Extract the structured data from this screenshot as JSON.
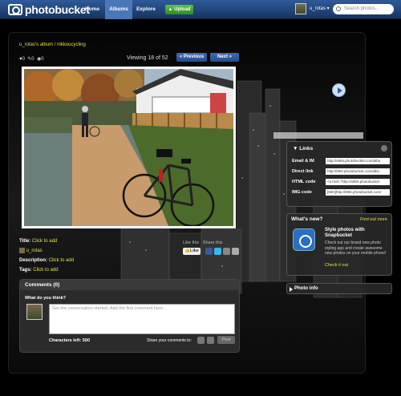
{
  "topbar": {
    "logo": "photobucket",
    "nav": [
      "Home",
      "Albums",
      "Explore"
    ],
    "active_nav": "Albums",
    "upload": "Upload",
    "username": "u_rotas",
    "search_placeholder": "Search photos..."
  },
  "album": {
    "breadcrumb": "u_rotas's album / nikkoucycling",
    "counts": [
      "0",
      "0",
      "0"
    ],
    "viewing": "Viewing 18 of 52",
    "prev": "« Previous",
    "next": "Next »"
  },
  "links": {
    "title": "Links",
    "rows": [
      {
        "label": "Email & IM",
        "value": "http://s994.photobucket.com/albu"
      },
      {
        "label": "Direct link",
        "value": "http://i994.photobucket.com/albu"
      },
      {
        "label": "HTML code",
        "value": "<a href=\"http://s994.photobucket"
      },
      {
        "label": "IMG code",
        "value": "[IMG]http://i994.photobucket.com/"
      }
    ]
  },
  "whats_new": {
    "title": "What's new?",
    "find_more": "Find out more",
    "headline": "Style photos with Snapbucket",
    "description": "Check out our brand new photo styling app and create awesome new photos on your mobile phone!",
    "cta": "Check it out"
  },
  "photo_info": "Photo info",
  "meta": {
    "title_label": "Title:",
    "title_link": "Click to add",
    "owner": "u_rotas",
    "description_label": "Description:",
    "description_link": "Click to add",
    "tags_label": "Tags:",
    "tags_link": "Click to add",
    "like_this": "Like this",
    "share_this": "Share this",
    "like_button": "Like"
  },
  "comments": {
    "header": "Comments (0)",
    "question": "What do you think?",
    "placeholder": "Get the conversation started.  Add the first comment here...",
    "chars_left": "Characters left: 500",
    "share_label": "Share your comments to:",
    "post": "Post"
  },
  "colors": {
    "topbar": "#1f4478",
    "accent_link": "#e2e24a",
    "upload_green": "#3a9e2c"
  }
}
